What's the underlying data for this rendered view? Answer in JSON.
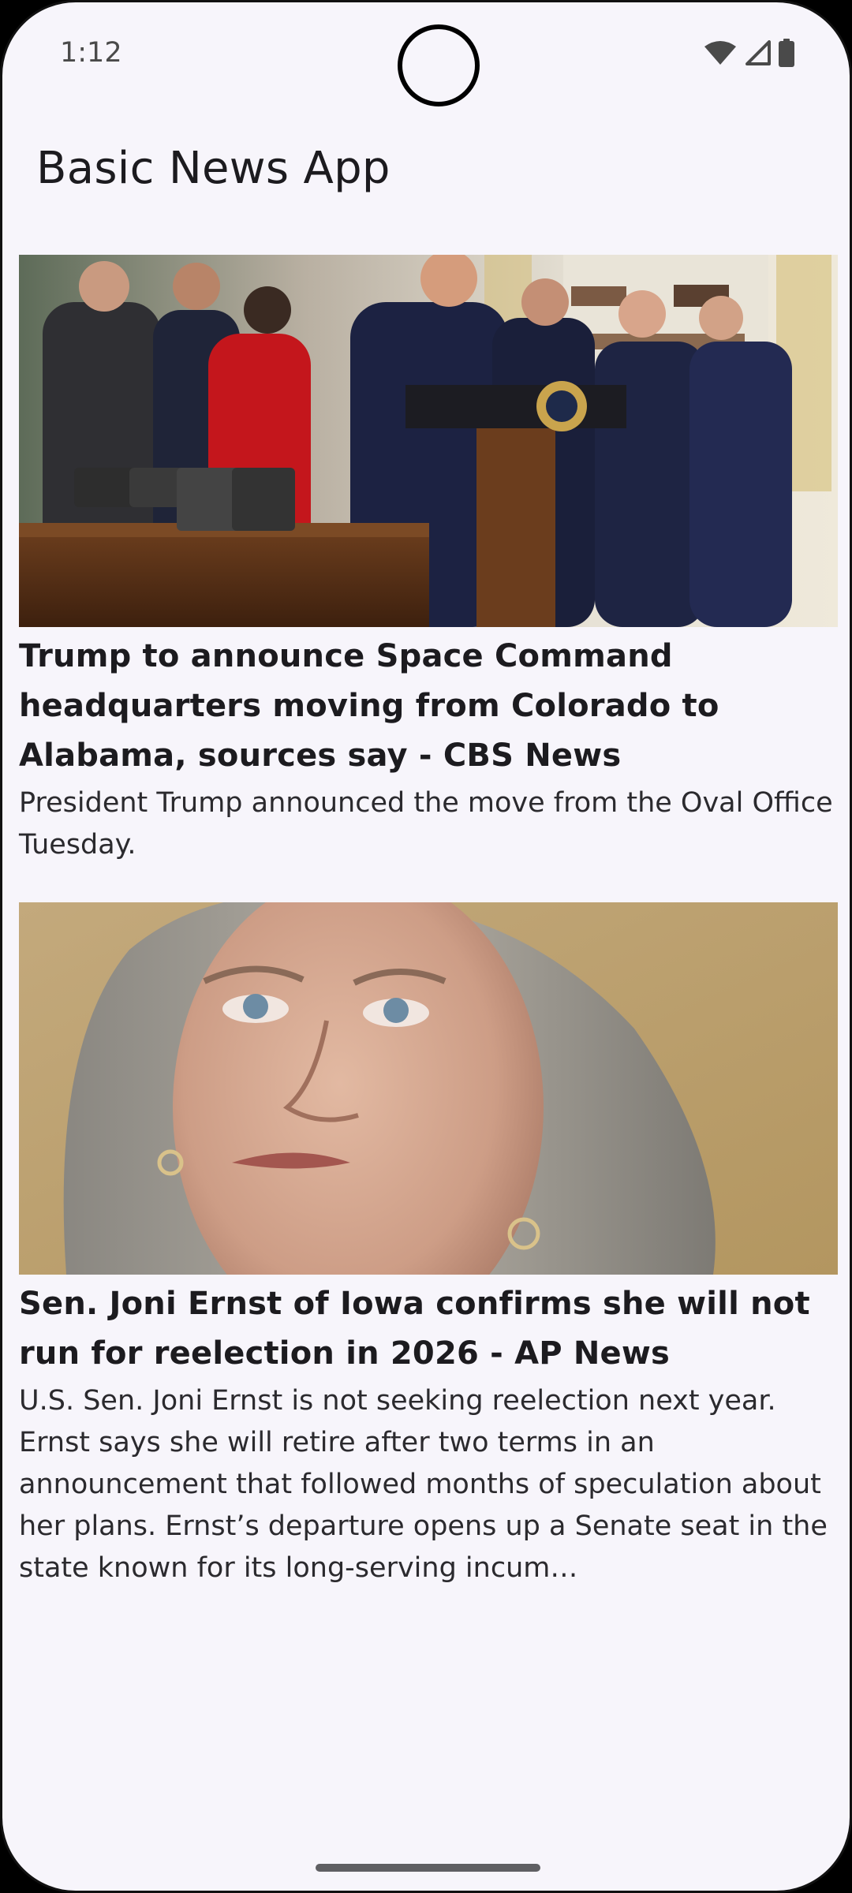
{
  "status_bar": {
    "time": "1:12",
    "icons": [
      "wifi-icon",
      "cellular-signal-icon",
      "battery-icon"
    ]
  },
  "app_bar": {
    "title": "Basic News App"
  },
  "articles": [
    {
      "title": "Trump to announce Space Command headquarters moving from Colorado to Alabama, sources say - CBS News",
      "description": "President Trump announced the move from the Oval Office Tuesday.",
      "image": "photo-group-at-podium"
    },
    {
      "title": "Sen. Joni Ernst of Iowa confirms she will not run for reelection in 2026 - AP News",
      "description": "U.S. Sen. Joni Ernst is not seeking reelection next year. Ernst says she will retire after two terms in an announcement that followed months of speculation about her plans. Ernst’s departure opens up a Senate seat in the state known for its long-serving incum…",
      "image": "photo-portrait"
    }
  ],
  "colors": {
    "background": "#f7f5fb",
    "text_primary": "#1c1b1f"
  }
}
